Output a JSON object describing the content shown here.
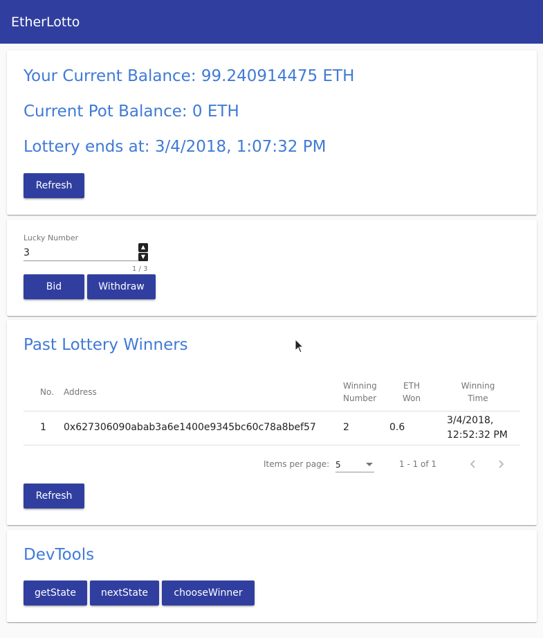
{
  "app": {
    "title": "EtherLotto"
  },
  "status": {
    "balance_text": "Your Current Balance: 99.240914475 ETH",
    "pot_text": "Current Pot Balance: 0 ETH",
    "ends_text": "Lottery ends at: 3/4/2018, 1:07:32 PM",
    "refresh_label": "Refresh"
  },
  "bid": {
    "field_label": "Lucky Number",
    "field_value": "3",
    "hint": "1 / 3",
    "bid_label": "Bid",
    "withdraw_label": "Withdraw"
  },
  "winners": {
    "title": "Past Lottery Winners",
    "columns": {
      "no": "No.",
      "address": "Address",
      "winning_number_1": "Winning",
      "winning_number_2": "Number",
      "eth_won_1": "ETH",
      "eth_won_2": "Won",
      "winning_time_1": "Winning",
      "winning_time_2": "Time"
    },
    "rows": [
      {
        "no": "1",
        "address": "0x627306090abab3a6e1400e9345bc60c78a8bef57",
        "winning_number": "2",
        "eth_won": "0.6",
        "time_line1": "3/4/2018,",
        "time_line2": "12:52:32 PM"
      }
    ],
    "paginator": {
      "items_per_page_label": "Items per page:",
      "items_per_page_value": "5",
      "range_label": "1 - 1 of 1"
    },
    "refresh_label": "Refresh"
  },
  "devtools": {
    "title": "DevTools",
    "get_state_label": "getState",
    "next_state_label": "nextState",
    "choose_winner_label": "chooseWinner"
  },
  "colors": {
    "primary": "#303f9f",
    "heading_blue": "#3f7ad6"
  },
  "icons": {
    "prev": "chevron-left-icon",
    "next": "chevron-right-icon",
    "dropdown": "arrow-drop-down-icon",
    "cursor": "mouse-pointer-icon"
  }
}
